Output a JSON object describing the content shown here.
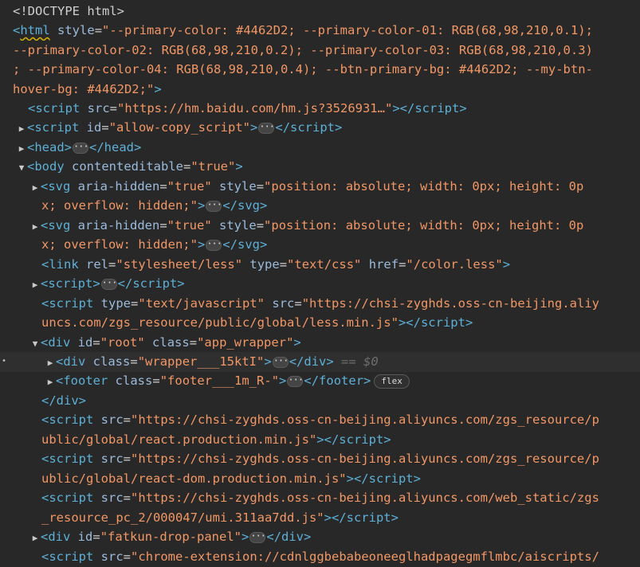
{
  "doctype": "<!DOCTYPE html>",
  "html_open_1": "--primary-color: #4462D2; --primary-color-01: RGB(68,98,210,0.1);",
  "html_open_2": "--primary-color-02: RGB(68,98,210,0.2); --primary-color-03: RGB(68,98,210,0.3)",
  "html_open_3": "; --primary-color-04: RGB(68,98,210,0.4); --btn-primary-bg: #4462D2; --my-btn-",
  "html_open_4": "hover-bg: #4462D2;",
  "hm_src": "https://hm.baidu.com/hm.js?3526931…",
  "allow_copy_id": "allow-copy_script",
  "svg_style_1": "position: absolute; width: 0px; height: 0p",
  "svg_style_2": "x; overflow: hidden;",
  "link_rel": "stylesheet/less",
  "link_type": "text/css",
  "link_href": "/color.less",
  "script_type": "text/javascript",
  "less_src_1": "https://chsi-zyghds.oss-cn-beijing.aliy",
  "less_src_2": "uncs.com/zgs_resource/public/global/less.min.js",
  "root_id": "root",
  "root_class": "app_wrapper",
  "wrapper_class": "wrapper___15ktI",
  "selected_marker": "== $0",
  "footer_class": "footer___1m_R-",
  "flex_badge": "flex",
  "react_src_1": "https://chsi-zyghds.oss-cn-beijing.aliyuncs.com/zgs_resource/p",
  "react_src_2": "ublic/global/react.production.min.js",
  "reactdom_src_1": "https://chsi-zyghds.oss-cn-beijing.aliyuncs.com/zgs_resource/p",
  "reactdom_src_2": "ublic/global/react-dom.production.min.js",
  "umi_src_1": "https://chsi-zyghds.oss-cn-beijing.aliyuncs.com/web_static/zgs",
  "umi_src_2": "_resource_pc_2/000047/umi.311aa7dd.js",
  "fatkun_id": "fatkun-drop-panel",
  "chrome_src": "chrome-extension://cdnlggbebabeoneeglhadpagegmflmbc/aiscripts/"
}
